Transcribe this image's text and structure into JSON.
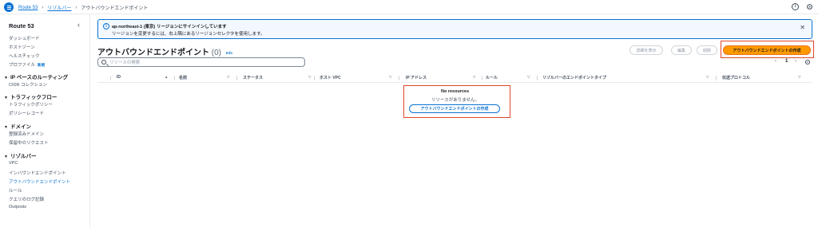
{
  "breadcrumb": {
    "items": [
      "Route 53",
      "リゾルバー"
    ],
    "current": "アウトバウンドエンドポイント"
  },
  "sidebar": {
    "title": "Route 53",
    "top_items": [
      "ダッシュボード",
      "ホストゾーン",
      "ヘルスチェック",
      "プロファイル"
    ],
    "new_badge": "新規",
    "sections": [
      {
        "title": "IP ベースのルーティング",
        "items": [
          "CIDR コレクション"
        ]
      },
      {
        "title": "トラフィックフロー",
        "items": [
          "トラフィックポリシー",
          "ポリシーレコード"
        ]
      },
      {
        "title": "ドメイン",
        "items": [
          "登録済みドメイン",
          "保留中のリクエスト"
        ]
      },
      {
        "title": "リゾルバー",
        "items": [
          "VPC",
          "インバウンドエンドポイント",
          "アウトバウンドエンドポイント",
          "ルール",
          "クエリのログ記録",
          "Outposts"
        ]
      }
    ]
  },
  "banner": {
    "title": "ap-northeast-1 (東京) リージョンにサインインしています",
    "text": "リージョンを変更するには、右上隅にあるリージョンセレクタを使用します。"
  },
  "page": {
    "title": "アウトバウンドエンドポイント",
    "count": "(0)",
    "info": "Info"
  },
  "actions": {
    "details": "詳細を表示",
    "edit": "編集",
    "delete": "削除",
    "create": "アウトバウンドエンドポイントの作成"
  },
  "search": {
    "placeholder": "リソースの検索"
  },
  "pagination": {
    "prev": "‹",
    "page": "1",
    "next": "›"
  },
  "table": {
    "columns": [
      "ID",
      "名前",
      "ステータス",
      "ホスト VPC",
      "IP アドレス",
      "ルール",
      "リゾルバーのエンドポイントタイプ",
      "伝送プロトコル"
    ]
  },
  "empty": {
    "title": "No resources",
    "text": "リソースがありません。",
    "button": "アウトバウンドエンドポイントの作成"
  },
  "colors": {
    "accent": "#0972d3",
    "primary": "#ff9900",
    "highlight": "#e0472b"
  }
}
